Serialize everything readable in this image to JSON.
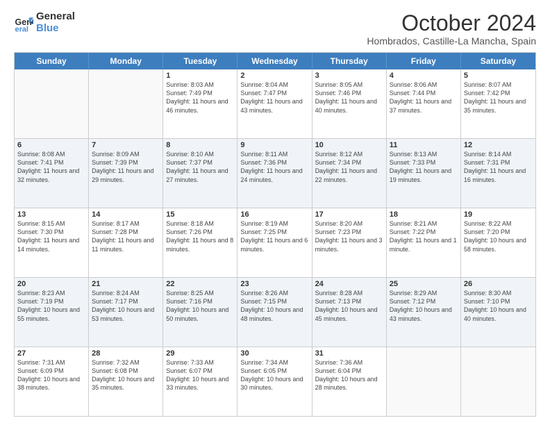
{
  "logo": {
    "line1": "General",
    "line2": "Blue"
  },
  "title": "October 2024",
  "location": "Hombrados, Castille-La Mancha, Spain",
  "days_of_week": [
    "Sunday",
    "Monday",
    "Tuesday",
    "Wednesday",
    "Thursday",
    "Friday",
    "Saturday"
  ],
  "weeks": [
    [
      {
        "day": "",
        "info": ""
      },
      {
        "day": "",
        "info": ""
      },
      {
        "day": "1",
        "info": "Sunrise: 8:03 AM\nSunset: 7:49 PM\nDaylight: 11 hours and 46 minutes."
      },
      {
        "day": "2",
        "info": "Sunrise: 8:04 AM\nSunset: 7:47 PM\nDaylight: 11 hours and 43 minutes."
      },
      {
        "day": "3",
        "info": "Sunrise: 8:05 AM\nSunset: 7:46 PM\nDaylight: 11 hours and 40 minutes."
      },
      {
        "day": "4",
        "info": "Sunrise: 8:06 AM\nSunset: 7:44 PM\nDaylight: 11 hours and 37 minutes."
      },
      {
        "day": "5",
        "info": "Sunrise: 8:07 AM\nSunset: 7:42 PM\nDaylight: 11 hours and 35 minutes."
      }
    ],
    [
      {
        "day": "6",
        "info": "Sunrise: 8:08 AM\nSunset: 7:41 PM\nDaylight: 11 hours and 32 minutes."
      },
      {
        "day": "7",
        "info": "Sunrise: 8:09 AM\nSunset: 7:39 PM\nDaylight: 11 hours and 29 minutes."
      },
      {
        "day": "8",
        "info": "Sunrise: 8:10 AM\nSunset: 7:37 PM\nDaylight: 11 hours and 27 minutes."
      },
      {
        "day": "9",
        "info": "Sunrise: 8:11 AM\nSunset: 7:36 PM\nDaylight: 11 hours and 24 minutes."
      },
      {
        "day": "10",
        "info": "Sunrise: 8:12 AM\nSunset: 7:34 PM\nDaylight: 11 hours and 22 minutes."
      },
      {
        "day": "11",
        "info": "Sunrise: 8:13 AM\nSunset: 7:33 PM\nDaylight: 11 hours and 19 minutes."
      },
      {
        "day": "12",
        "info": "Sunrise: 8:14 AM\nSunset: 7:31 PM\nDaylight: 11 hours and 16 minutes."
      }
    ],
    [
      {
        "day": "13",
        "info": "Sunrise: 8:15 AM\nSunset: 7:30 PM\nDaylight: 11 hours and 14 minutes."
      },
      {
        "day": "14",
        "info": "Sunrise: 8:17 AM\nSunset: 7:28 PM\nDaylight: 11 hours and 11 minutes."
      },
      {
        "day": "15",
        "info": "Sunrise: 8:18 AM\nSunset: 7:26 PM\nDaylight: 11 hours and 8 minutes."
      },
      {
        "day": "16",
        "info": "Sunrise: 8:19 AM\nSunset: 7:25 PM\nDaylight: 11 hours and 6 minutes."
      },
      {
        "day": "17",
        "info": "Sunrise: 8:20 AM\nSunset: 7:23 PM\nDaylight: 11 hours and 3 minutes."
      },
      {
        "day": "18",
        "info": "Sunrise: 8:21 AM\nSunset: 7:22 PM\nDaylight: 11 hours and 1 minute."
      },
      {
        "day": "19",
        "info": "Sunrise: 8:22 AM\nSunset: 7:20 PM\nDaylight: 10 hours and 58 minutes."
      }
    ],
    [
      {
        "day": "20",
        "info": "Sunrise: 8:23 AM\nSunset: 7:19 PM\nDaylight: 10 hours and 55 minutes."
      },
      {
        "day": "21",
        "info": "Sunrise: 8:24 AM\nSunset: 7:17 PM\nDaylight: 10 hours and 53 minutes."
      },
      {
        "day": "22",
        "info": "Sunrise: 8:25 AM\nSunset: 7:16 PM\nDaylight: 10 hours and 50 minutes."
      },
      {
        "day": "23",
        "info": "Sunrise: 8:26 AM\nSunset: 7:15 PM\nDaylight: 10 hours and 48 minutes."
      },
      {
        "day": "24",
        "info": "Sunrise: 8:28 AM\nSunset: 7:13 PM\nDaylight: 10 hours and 45 minutes."
      },
      {
        "day": "25",
        "info": "Sunrise: 8:29 AM\nSunset: 7:12 PM\nDaylight: 10 hours and 43 minutes."
      },
      {
        "day": "26",
        "info": "Sunrise: 8:30 AM\nSunset: 7:10 PM\nDaylight: 10 hours and 40 minutes."
      }
    ],
    [
      {
        "day": "27",
        "info": "Sunrise: 7:31 AM\nSunset: 6:09 PM\nDaylight: 10 hours and 38 minutes."
      },
      {
        "day": "28",
        "info": "Sunrise: 7:32 AM\nSunset: 6:08 PM\nDaylight: 10 hours and 35 minutes."
      },
      {
        "day": "29",
        "info": "Sunrise: 7:33 AM\nSunset: 6:07 PM\nDaylight: 10 hours and 33 minutes."
      },
      {
        "day": "30",
        "info": "Sunrise: 7:34 AM\nSunset: 6:05 PM\nDaylight: 10 hours and 30 minutes."
      },
      {
        "day": "31",
        "info": "Sunrise: 7:36 AM\nSunset: 6:04 PM\nDaylight: 10 hours and 28 minutes."
      },
      {
        "day": "",
        "info": ""
      },
      {
        "day": "",
        "info": ""
      }
    ]
  ]
}
